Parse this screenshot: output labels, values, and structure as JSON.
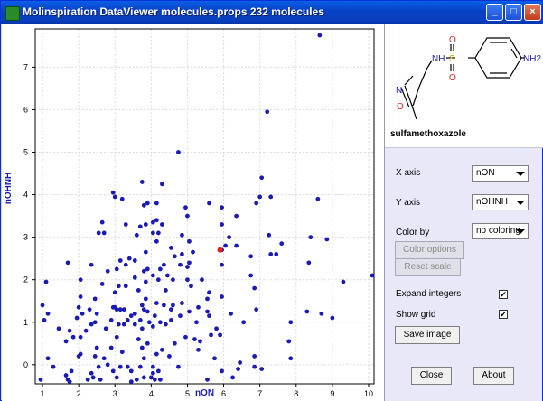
{
  "window": {
    "title": "Molinspiration DataViewer molecules.props 232 molecules",
    "minimize_glyph": "_",
    "maximize_glyph": "□",
    "close_glyph": "×"
  },
  "molecule": {
    "name": "sulfamethoxazole",
    "atom_labels": {
      "nh": "NH",
      "s": "S",
      "o_top": "O",
      "o_bottom": "O",
      "nh2": "NH2",
      "ring_o": "O",
      "ring_n": "N"
    }
  },
  "controls": {
    "x_axis_label": "X axis",
    "x_axis_value": "nON",
    "y_axis_label": "Y axis",
    "y_axis_value": "nOHNH",
    "color_by_label": "Color by",
    "color_by_value": "no coloring",
    "color_options_label": "Color options",
    "reset_scale_label": "Reset scale",
    "expand_integers_label": "Expand integers",
    "expand_integers_mark": "✔",
    "show_grid_label": "Show grid",
    "show_grid_mark": "✔",
    "save_image_label": "Save image",
    "close_label": "Close",
    "about_label": "About"
  },
  "colors": {
    "point": "#1a1ab8",
    "highlight": "#e8201a",
    "axis_label": "#1a1ab8",
    "grid": "#dcdcdc"
  },
  "chart_data": {
    "type": "scatter",
    "xlabel": "nON",
    "ylabel": "nOHNH",
    "xlim": [
      0.8,
      10.15
    ],
    "ylim": [
      -0.45,
      7.9
    ],
    "x_ticks": [
      1,
      2,
      3,
      4,
      5,
      6,
      7,
      8,
      9,
      10
    ],
    "y_ticks": [
      0,
      1,
      2,
      3,
      4,
      5,
      6,
      7
    ],
    "grid": true,
    "highlight": {
      "x": 5.9,
      "y": 2.7
    },
    "points": [
      [
        8.65,
        7.75
      ],
      [
        7.2,
        5.95
      ],
      [
        4.75,
        5.0
      ],
      [
        7.05,
        4.4
      ],
      [
        4.3,
        4.25
      ],
      [
        3.75,
        4.3
      ],
      [
        2.95,
        4.05
      ],
      [
        3.0,
        3.95
      ],
      [
        7.0,
        3.95
      ],
      [
        7.3,
        3.95
      ],
      [
        8.6,
        3.9
      ],
      [
        3.2,
        3.9
      ],
      [
        3.9,
        3.8
      ],
      [
        6.9,
        3.8
      ],
      [
        4.15,
        3.8
      ],
      [
        5.6,
        3.8
      ],
      [
        3.8,
        3.75
      ],
      [
        5.95,
        3.7
      ],
      [
        4.95,
        3.7
      ],
      [
        5.0,
        3.5
      ],
      [
        6.35,
        3.5
      ],
      [
        2.65,
        3.35
      ],
      [
        4.15,
        3.4
      ],
      [
        5.95,
        3.3
      ],
      [
        3.85,
        3.3
      ],
      [
        4.05,
        3.35
      ],
      [
        3.3,
        3.3
      ],
      [
        3.7,
        3.25
      ],
      [
        4.3,
        3.3
      ],
      [
        2.55,
        3.1
      ],
      [
        2.7,
        3.1
      ],
      [
        3.6,
        3.05
      ],
      [
        4.05,
        3.1
      ],
      [
        7.25,
        3.05
      ],
      [
        4.85,
        3.05
      ],
      [
        4.2,
        3.1
      ],
      [
        6.15,
        3.0
      ],
      [
        8.4,
        3.0
      ],
      [
        8.85,
        2.95
      ],
      [
        5.05,
        2.9
      ],
      [
        4.15,
        2.9
      ],
      [
        6.05,
        2.8
      ],
      [
        6.35,
        2.8
      ],
      [
        7.6,
        2.85
      ],
      [
        4.55,
        2.75
      ],
      [
        3.85,
        2.65
      ],
      [
        5.15,
        2.65
      ],
      [
        4.85,
        2.6
      ],
      [
        5.95,
        2.7
      ],
      [
        7.3,
        2.6
      ],
      [
        7.45,
        2.6
      ],
      [
        3.4,
        2.5
      ],
      [
        4.65,
        2.55
      ],
      [
        6.75,
        2.55
      ],
      [
        3.15,
        2.45
      ],
      [
        3.55,
        2.45
      ],
      [
        4.35,
        2.35
      ],
      [
        4.8,
        2.35
      ],
      [
        5.0,
        2.3
      ],
      [
        3.3,
        2.35
      ],
      [
        5.05,
        2.4
      ],
      [
        5.95,
        2.35
      ],
      [
        8.35,
        2.4
      ],
      [
        2.35,
        2.35
      ],
      [
        1.7,
        2.4
      ],
      [
        3.9,
        2.25
      ],
      [
        3.05,
        2.25
      ],
      [
        4.25,
        2.25
      ],
      [
        3.8,
        2.2
      ],
      [
        2.8,
        2.2
      ],
      [
        4.05,
        2.1
      ],
      [
        4.45,
        2.1
      ],
      [
        5.4,
        2.0
      ],
      [
        6.75,
        2.1
      ],
      [
        2.05,
        2.0
      ],
      [
        3.55,
        2.05
      ],
      [
        3.85,
        1.95
      ],
      [
        4.2,
        2.0
      ],
      [
        4.6,
        2.0
      ],
      [
        5.0,
        2.0
      ],
      [
        1.1,
        1.95
      ],
      [
        2.65,
        1.9
      ],
      [
        3.1,
        1.85
      ],
      [
        3.3,
        1.85
      ],
      [
        5.1,
        1.85
      ],
      [
        6.85,
        1.8
      ],
      [
        3.65,
        1.75
      ],
      [
        4.4,
        1.75
      ],
      [
        5.6,
        1.7
      ],
      [
        3.0,
        1.7
      ],
      [
        5.95,
        1.6
      ],
      [
        2.05,
        1.6
      ],
      [
        3.85,
        1.55
      ],
      [
        2.45,
        1.55
      ],
      [
        5.55,
        1.55
      ],
      [
        4.15,
        1.45
      ],
      [
        4.35,
        1.4
      ],
      [
        4.85,
        1.45
      ],
      [
        4.6,
        1.4
      ],
      [
        3.75,
        1.4
      ],
      [
        3.0,
        1.35
      ],
      [
        2.95,
        1.35
      ],
      [
        3.15,
        1.3
      ],
      [
        5.3,
        1.35
      ],
      [
        3.8,
        1.3
      ],
      [
        3.25,
        1.3
      ],
      [
        4.55,
        1.3
      ],
      [
        2.0,
        1.35
      ],
      [
        2.3,
        1.3
      ],
      [
        3.9,
        1.25
      ],
      [
        3.05,
        1.3
      ],
      [
        5.05,
        1.25
      ],
      [
        5.55,
        1.25
      ],
      [
        6.9,
        1.3
      ],
      [
        1.0,
        1.4
      ],
      [
        2.1,
        1.2
      ],
      [
        3.55,
        1.2
      ],
      [
        2.5,
        1.2
      ],
      [
        1.15,
        1.2
      ],
      [
        3.45,
        1.15
      ],
      [
        4.1,
        1.15
      ],
      [
        4.8,
        1.15
      ],
      [
        5.6,
        1.15
      ],
      [
        6.2,
        1.2
      ],
      [
        8.3,
        1.25
      ],
      [
        8.7,
        1.2
      ],
      [
        9.0,
        1.1
      ],
      [
        1.05,
        1.05
      ],
      [
        1.95,
        1.1
      ],
      [
        2.45,
        1.0
      ],
      [
        2.9,
        1.05
      ],
      [
        3.35,
        1.05
      ],
      [
        3.7,
        1.05
      ],
      [
        4.25,
        1.0
      ],
      [
        4.55,
        1.05
      ],
      [
        5.25,
        1.0
      ],
      [
        6.55,
        1.0
      ],
      [
        7.85,
        1.0
      ],
      [
        3.95,
        1.0
      ],
      [
        1.45,
        0.85
      ],
      [
        1.75,
        0.8
      ],
      [
        2.2,
        0.8
      ],
      [
        2.75,
        0.85
      ],
      [
        3.1,
        0.95
      ],
      [
        3.55,
        0.95
      ],
      [
        4.05,
        0.9
      ],
      [
        4.4,
        0.95
      ],
      [
        5.8,
        0.85
      ],
      [
        2.35,
        0.95
      ],
      [
        3.25,
        0.95
      ],
      [
        3.75,
        0.85
      ],
      [
        1.85,
        0.65
      ],
      [
        2.05,
        0.65
      ],
      [
        3.05,
        0.65
      ],
      [
        3.65,
        0.6
      ],
      [
        4.95,
        0.65
      ],
      [
        5.2,
        0.6
      ],
      [
        5.65,
        0.7
      ],
      [
        5.9,
        0.7
      ],
      [
        1.65,
        0.55
      ],
      [
        3.9,
        0.5
      ],
      [
        4.65,
        0.5
      ],
      [
        5.35,
        0.55
      ],
      [
        7.8,
        0.55
      ],
      [
        2.5,
        0.4
      ],
      [
        2.9,
        0.4
      ],
      [
        3.75,
        0.4
      ],
      [
        4.3,
        0.35
      ],
      [
        3.2,
        0.3
      ],
      [
        5.3,
        0.35
      ],
      [
        2.05,
        0.25
      ],
      [
        4.15,
        0.25
      ],
      [
        1.15,
        0.15
      ],
      [
        2.0,
        0.2
      ],
      [
        2.45,
        0.2
      ],
      [
        2.7,
        0.15
      ],
      [
        3.8,
        0.15
      ],
      [
        4.5,
        0.2
      ],
      [
        5.75,
        0.15
      ],
      [
        6.85,
        0.2
      ],
      [
        7.85,
        0.15
      ],
      [
        1.3,
        -0.05
      ],
      [
        2.55,
        -0.05
      ],
      [
        3.15,
        -0.05
      ],
      [
        3.35,
        -0.05
      ],
      [
        3.7,
        -0.05
      ],
      [
        4.05,
        -0.05
      ],
      [
        4.75,
        -0.05
      ],
      [
        6.45,
        0.05
      ],
      [
        2.8,
        0.0
      ],
      [
        1.8,
        -0.15
      ],
      [
        2.35,
        -0.2
      ],
      [
        2.95,
        -0.15
      ],
      [
        3.45,
        -0.15
      ],
      [
        4.05,
        -0.2
      ],
      [
        4.2,
        -0.15
      ],
      [
        5.95,
        -0.15
      ],
      [
        6.4,
        -0.1
      ],
      [
        1.65,
        -0.25
      ],
      [
        2.4,
        -0.3
      ],
      [
        2.6,
        -0.35
      ],
      [
        3.05,
        -0.3
      ],
      [
        3.8,
        -0.3
      ],
      [
        4.1,
        -0.35
      ],
      [
        6.25,
        -0.3
      ],
      [
        1.75,
        -0.4
      ],
      [
        1.7,
        -0.35
      ],
      [
        4.25,
        -0.35
      ],
      [
        5.55,
        -0.35
      ],
      [
        3.6,
        -0.35
      ],
      [
        0.95,
        -0.35
      ],
      [
        2.25,
        -0.35
      ],
      [
        6.85,
        -0.05
      ],
      [
        7.05,
        -0.1
      ],
      [
        9.3,
        1.95
      ],
      [
        10.1,
        2.1
      ],
      [
        4.0,
        -0.3
      ],
      [
        3.45,
        -0.4
      ]
    ]
  }
}
